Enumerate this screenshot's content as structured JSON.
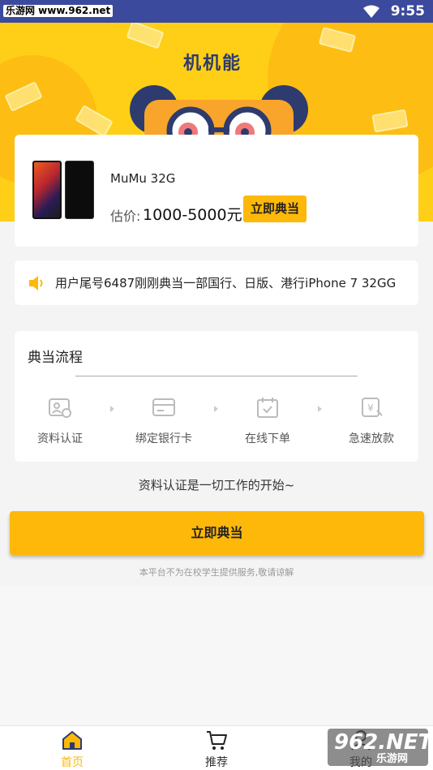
{
  "status_bar": {
    "carrier_badge": "乐游网 www.962.net",
    "time": "9:55"
  },
  "hero": {
    "title": "机机能"
  },
  "product": {
    "name": "MuMu   32G",
    "price_label": "估价:",
    "price": "1000-5000元",
    "button": "立即典当"
  },
  "notice": {
    "text": "用户尾号6487刚刚典当一部国行、日版、港行iPhone 7 32GG"
  },
  "process": {
    "title": "典当流程",
    "steps": [
      {
        "label": "资料认证",
        "icon": "id-card-icon"
      },
      {
        "label": "绑定银行卡",
        "icon": "bank-card-icon"
      },
      {
        "label": "在线下单",
        "icon": "calendar-check-icon"
      },
      {
        "label": "急速放款",
        "icon": "money-icon"
      }
    ]
  },
  "tagline": "资料认证是一切工作的开始~",
  "main_button": "立即典当",
  "disclaimer": "本平台不为在校学生提供服务,敬请谅解",
  "tabs": [
    {
      "label": "首页",
      "icon": "home-icon",
      "active": true
    },
    {
      "label": "推荐",
      "icon": "cart-icon",
      "active": false
    },
    {
      "label": "我的",
      "icon": "user-icon",
      "active": false
    }
  ],
  "watermark": {
    "big": "962.NET",
    "small": "乐游网"
  },
  "colors": {
    "accent": "#fdb809",
    "hero": "#fecf16",
    "status_bar": "#3b4a9c"
  }
}
